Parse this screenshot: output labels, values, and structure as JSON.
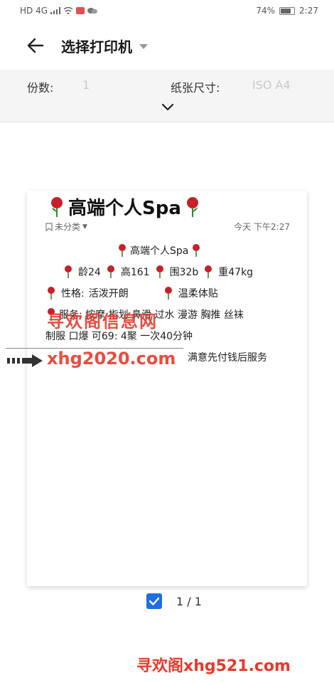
{
  "status_bar": {
    "network": "HD 4G",
    "battery": "74%",
    "time": "2:27"
  },
  "app_bar": {
    "title": "选择打印机"
  },
  "settings": {
    "copies_label": "份数:",
    "copies_value": "1",
    "paper_size_label": "纸张尺寸:",
    "paper_size_value": "ISO A4"
  },
  "preview": {
    "title": "高端个人Spa",
    "category": "未分类",
    "timestamp": "今天 下午2:27",
    "line1": "高端个人Spa",
    "age": "龄24",
    "height": "高161",
    "bust": "围32b",
    "weight": "重47kg",
    "personality_label": "性格:",
    "personality_value": "活泼开朗",
    "personality_extra": "温柔体贴",
    "services": "服务: 按摩 指划 鼻滑 过水 漫游 胸推 丝袜",
    "services2": "制服 口爆 可69: 4聚 一次40分钟",
    "footer_right": "满意先付钱后服务"
  },
  "watermarks": {
    "top": "寻欢阁信息网",
    "middle": "xhg2020.com",
    "bottom": "寻欢阁xhg521.com"
  },
  "pages": {
    "count": "1 / 1"
  },
  "colors": {
    "accent": "#1f6fe0",
    "watermark": "#e8392b"
  }
}
